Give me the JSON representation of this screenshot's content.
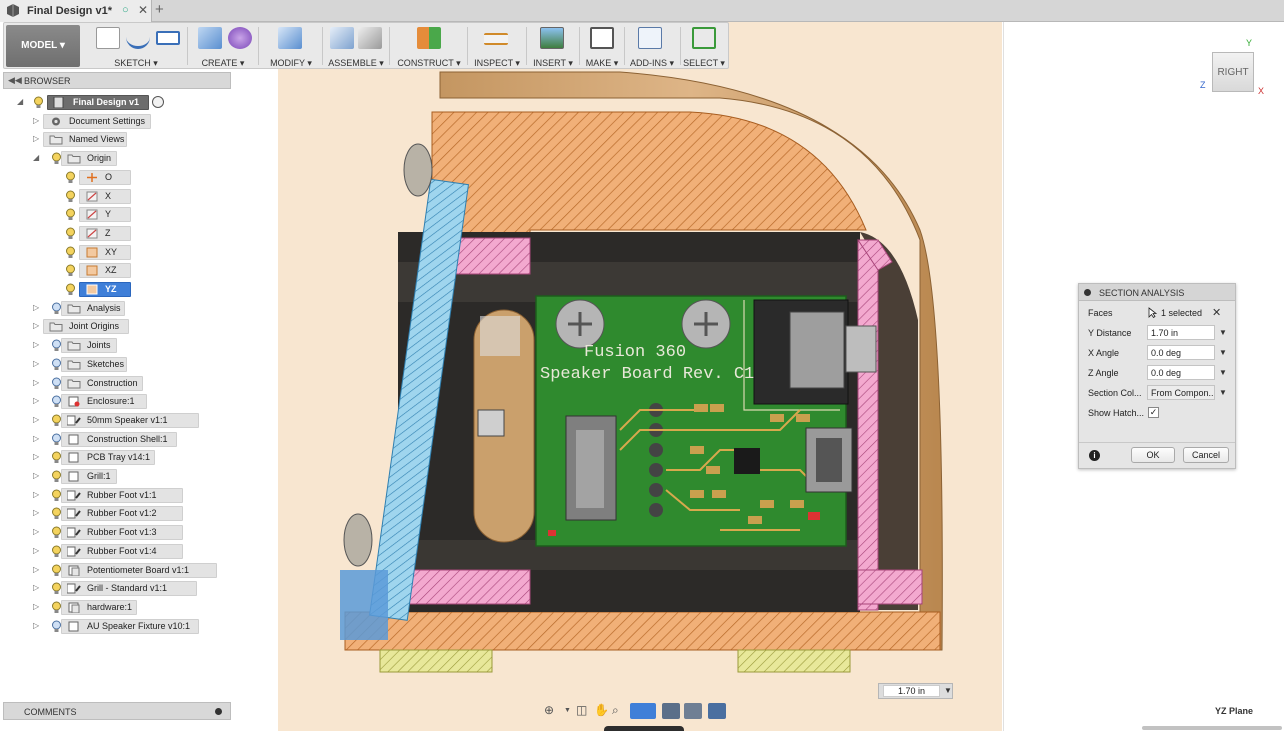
{
  "document": {
    "tab_title": "Final Design v1*",
    "tab_status_icon": "sync-circle-icon",
    "new_tab_label": "+"
  },
  "toolbar": {
    "workspace": "MODEL ▾",
    "groups": [
      {
        "label": "SKETCH ▾"
      },
      {
        "label": "CREATE ▾"
      },
      {
        "label": "MODIFY ▾"
      },
      {
        "label": "ASSEMBLE ▾"
      },
      {
        "label": "CONSTRUCT ▾"
      },
      {
        "label": "INSPECT ▾"
      },
      {
        "label": "INSERT ▾"
      },
      {
        "label": "MAKE ▾"
      },
      {
        "label": "ADD-INS ▾"
      },
      {
        "label": "SELECT ▾"
      }
    ]
  },
  "browser": {
    "title": "BROWSER",
    "root": "Final Design v1",
    "items": [
      {
        "label": "Document Settings"
      },
      {
        "label": "Named Views"
      },
      {
        "label": "Origin"
      },
      {
        "label": "O"
      },
      {
        "label": "X"
      },
      {
        "label": "Y"
      },
      {
        "label": "Z"
      },
      {
        "label": "XY"
      },
      {
        "label": "XZ"
      },
      {
        "label": "YZ"
      },
      {
        "label": "Analysis"
      },
      {
        "label": "Joint Origins"
      },
      {
        "label": "Joints"
      },
      {
        "label": "Sketches"
      },
      {
        "label": "Construction"
      },
      {
        "label": "Enclosure:1"
      },
      {
        "label": "50mm Speaker v1:1"
      },
      {
        "label": "Construction Shell:1"
      },
      {
        "label": "PCB Tray v14:1"
      },
      {
        "label": "Grill:1"
      },
      {
        "label": "Rubber Foot v1:1"
      },
      {
        "label": "Rubber Foot v1:2"
      },
      {
        "label": "Rubber Foot v1:3"
      },
      {
        "label": "Rubber Foot v1:4"
      },
      {
        "label": "Potentiometer Board v1:1"
      },
      {
        "label": "Grill - Standard v1:1"
      },
      {
        "label": "hardware:1"
      },
      {
        "label": "AU Speaker Fixture v10:1"
      }
    ]
  },
  "section_analysis": {
    "title": "SECTION ANALYSIS",
    "faces_label": "Faces",
    "faces_value": "1 selected",
    "y_distance_label": "Y Distance",
    "y_distance_value": "1.70 in",
    "x_angle_label": "X Angle",
    "x_angle_value": "0.0 deg",
    "z_angle_label": "Z Angle",
    "z_angle_value": "0.0 deg",
    "section_color_label": "Section Col...",
    "section_color_value": "From Compon...",
    "show_hatch_label": "Show Hatch...",
    "show_hatch_checked": true,
    "ok_label": "OK",
    "cancel_label": "Cancel"
  },
  "viewcube": {
    "face": "RIGHT",
    "axis_y": "Y",
    "axis_z": "Z",
    "axis_x": "X"
  },
  "pcb": {
    "line1": "Fusion 360",
    "line2": "Speaker Board Rev. C1"
  },
  "distance_input": "1.70 in",
  "comments_label": "COMMENTS",
  "plane_label": "YZ Plane",
  "colors": {
    "section_orange": "#e8a050",
    "section_pink": "#e890c0",
    "section_blue": "#5aa9d6",
    "pcb_green": "#2f8a2e",
    "wood": "#c7935c",
    "selection_blue": "#3f7fd8"
  }
}
